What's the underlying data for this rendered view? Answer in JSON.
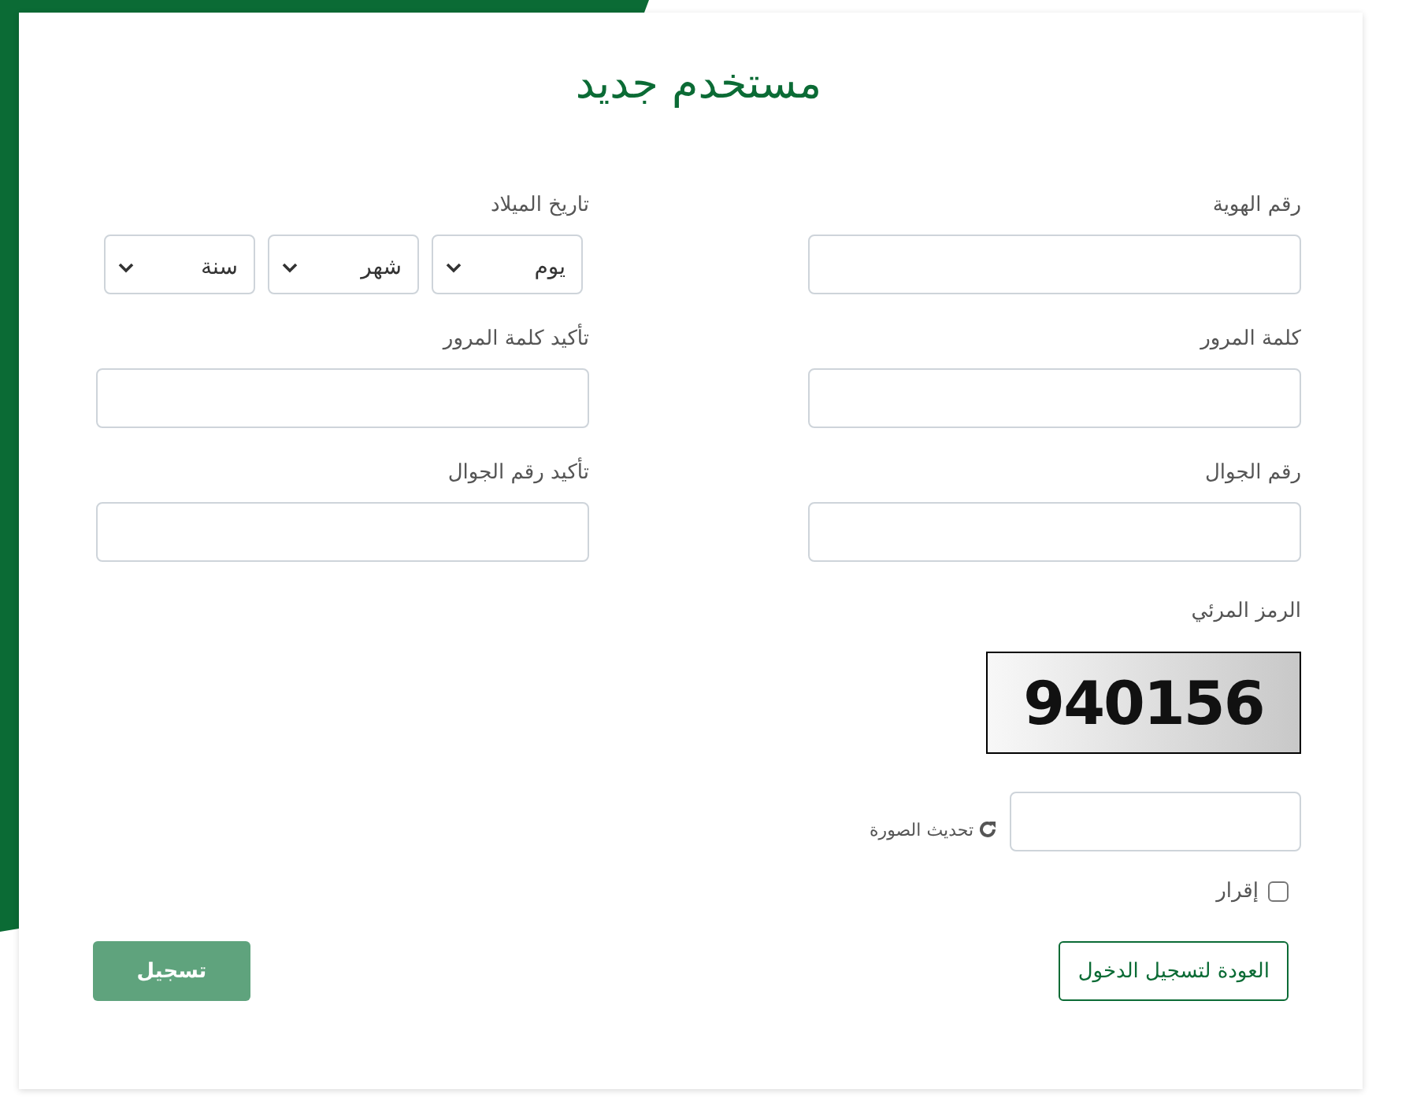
{
  "title": "مستخدم جديد",
  "rows": [
    {
      "right": {
        "label": "رقم الهوية",
        "kind": "text"
      },
      "left": {
        "label": "تاريخ الميلاد",
        "kind": "date",
        "selects": [
          "يوم",
          "شهر",
          "سنة"
        ]
      }
    },
    {
      "right": {
        "label": "كلمة المرور",
        "kind": "text"
      },
      "left": {
        "label": "تأكيد كلمة المرور",
        "kind": "text"
      }
    },
    {
      "right": {
        "label": "رقم الجوال",
        "kind": "text"
      },
      "left": {
        "label": "تأكيد رقم الجوال",
        "kind": "text"
      }
    }
  ],
  "captcha": {
    "label": "الرمز المرئي",
    "code": "940156",
    "refresh": "تحديث الصورة"
  },
  "acknowledgment": {
    "label": "إقرار",
    "checked": false
  },
  "back_button": {
    "label": "العودة لتسجيل الدخول"
  },
  "register_button": {
    "label": "تسجيل",
    "disabled": true
  }
}
